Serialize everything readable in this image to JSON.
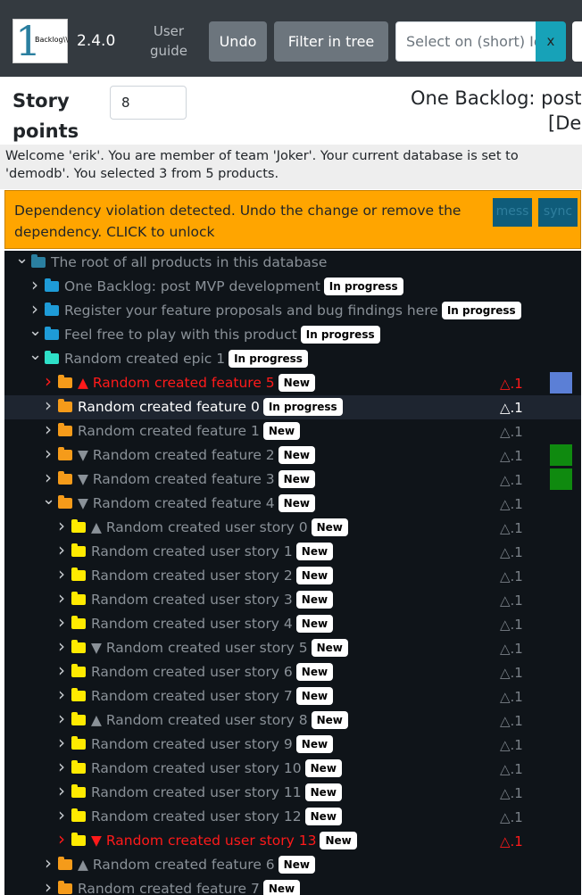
{
  "header": {
    "logo_text": "Backlog\\\\",
    "logo_number": "1",
    "version": "2.4.0",
    "user_guide": "User guide",
    "undo": "Undo",
    "filter": "Filter in tree",
    "select_placeholder": "Select on (short) Id",
    "clear": "x"
  },
  "story_points": {
    "label": "Story points",
    "value": "8"
  },
  "page_title": {
    "line1": "One Backlog: post",
    "line2": "[De"
  },
  "welcome": "Welcome 'erik'. You are member of team 'Joker'. Your current database is set to 'demodb'. You selected 3 from 5 products.",
  "alert": {
    "text": "Dependency violation detected. Undo the change or remove the dependency. CLICK to unlock",
    "mess": "mess",
    "sync": "sync"
  },
  "colors": {
    "navbar": "#343a40",
    "alert": "#ffa500",
    "tree_bg": "#0f1419",
    "violation": "#ff1a1a"
  },
  "tree": [
    {
      "name": "The root of all products in this database",
      "badge": "",
      "prefix": "",
      "chevron": "down",
      "folder": "root",
      "level": 0,
      "style": "normal",
      "delta": "",
      "marker": ""
    },
    {
      "name": "One Backlog: post MVP development",
      "badge": "In progress",
      "prefix": "",
      "chevron": "right",
      "folder": "blue",
      "level": 1,
      "style": "normal",
      "delta": "",
      "marker": ""
    },
    {
      "name": "Register your feature proposals and bug findings here",
      "badge": "In progress",
      "prefix": "",
      "chevron": "right",
      "folder": "blue",
      "level": 1,
      "style": "normal",
      "delta": "",
      "marker": ""
    },
    {
      "name": "Feel free to play with this product",
      "badge": "In progress",
      "prefix": "",
      "chevron": "down",
      "folder": "blue",
      "level": 1,
      "style": "normal",
      "delta": "",
      "marker": ""
    },
    {
      "name": "Random created epic 1",
      "badge": "In progress",
      "prefix": "",
      "chevron": "down",
      "folder": "teal",
      "level": 2,
      "style": "normal",
      "delta": "",
      "marker": ""
    },
    {
      "name": "Random created feature 5",
      "badge": "New",
      "prefix": "▲",
      "chevron": "right",
      "folder": "orange",
      "level": 3,
      "style": "red",
      "delta": "△.1",
      "marker": "blue"
    },
    {
      "name": "Random created feature 0",
      "badge": "In progress",
      "prefix": "",
      "chevron": "right",
      "folder": "orange",
      "level": 3,
      "style": "selected",
      "delta": "△.1",
      "marker": ""
    },
    {
      "name": "Random created feature 1",
      "badge": "New",
      "prefix": "",
      "chevron": "right",
      "folder": "orange",
      "level": 3,
      "style": "normal",
      "delta": "△.1",
      "marker": ""
    },
    {
      "name": "Random created feature 2",
      "badge": "New",
      "prefix": "▼",
      "chevron": "right",
      "folder": "orange",
      "level": 3,
      "style": "normal",
      "delta": "△.1",
      "marker": "green"
    },
    {
      "name": "Random created feature 3",
      "badge": "New",
      "prefix": "▼",
      "chevron": "right",
      "folder": "orange",
      "level": 3,
      "style": "normal",
      "delta": "△.1",
      "marker": "green"
    },
    {
      "name": "Random created feature 4",
      "badge": "New",
      "prefix": "▼",
      "chevron": "down",
      "folder": "orange",
      "level": 3,
      "style": "normal",
      "delta": "△.1",
      "marker": ""
    },
    {
      "name": "Random created user story 0",
      "badge": "New",
      "prefix": "▲",
      "chevron": "right",
      "folder": "yellow",
      "level": 4,
      "style": "normal",
      "delta": "△.1",
      "marker": ""
    },
    {
      "name": "Random created user story 1",
      "badge": "New",
      "prefix": "",
      "chevron": "right",
      "folder": "yellow",
      "level": 4,
      "style": "normal",
      "delta": "△.1",
      "marker": ""
    },
    {
      "name": "Random created user story 2",
      "badge": "New",
      "prefix": "",
      "chevron": "right",
      "folder": "yellow",
      "level": 4,
      "style": "normal",
      "delta": "△.1",
      "marker": ""
    },
    {
      "name": "Random created user story 3",
      "badge": "New",
      "prefix": "",
      "chevron": "right",
      "folder": "yellow",
      "level": 4,
      "style": "normal",
      "delta": "△.1",
      "marker": ""
    },
    {
      "name": "Random created user story 4",
      "badge": "New",
      "prefix": "",
      "chevron": "right",
      "folder": "yellow",
      "level": 4,
      "style": "normal",
      "delta": "△.1",
      "marker": ""
    },
    {
      "name": "Random created user story 5",
      "badge": "New",
      "prefix": "▼",
      "chevron": "right",
      "folder": "yellow",
      "level": 4,
      "style": "normal",
      "delta": "△.1",
      "marker": ""
    },
    {
      "name": "Random created user story 6",
      "badge": "New",
      "prefix": "",
      "chevron": "right",
      "folder": "yellow",
      "level": 4,
      "style": "normal",
      "delta": "△.1",
      "marker": ""
    },
    {
      "name": "Random created user story 7",
      "badge": "New",
      "prefix": "",
      "chevron": "right",
      "folder": "yellow",
      "level": 4,
      "style": "normal",
      "delta": "△.1",
      "marker": ""
    },
    {
      "name": "Random created user story 8",
      "badge": "New",
      "prefix": "▲",
      "chevron": "right",
      "folder": "yellow",
      "level": 4,
      "style": "normal",
      "delta": "△.1",
      "marker": ""
    },
    {
      "name": "Random created user story 9",
      "badge": "New",
      "prefix": "",
      "chevron": "right",
      "folder": "yellow",
      "level": 4,
      "style": "normal",
      "delta": "△.1",
      "marker": ""
    },
    {
      "name": "Random created user story 10",
      "badge": "New",
      "prefix": "",
      "chevron": "right",
      "folder": "yellow",
      "level": 4,
      "style": "normal",
      "delta": "△.1",
      "marker": ""
    },
    {
      "name": "Random created user story 11",
      "badge": "New",
      "prefix": "",
      "chevron": "right",
      "folder": "yellow",
      "level": 4,
      "style": "normal",
      "delta": "△.1",
      "marker": ""
    },
    {
      "name": "Random created user story 12",
      "badge": "New",
      "prefix": "",
      "chevron": "right",
      "folder": "yellow",
      "level": 4,
      "style": "normal",
      "delta": "△.1",
      "marker": ""
    },
    {
      "name": "Random created user story 13",
      "badge": "New",
      "prefix": "▼",
      "chevron": "right",
      "folder": "yellow",
      "level": 4,
      "style": "red",
      "delta": "△.1",
      "marker": ""
    },
    {
      "name": "Random created feature 6",
      "badge": "New",
      "prefix": "▲",
      "chevron": "right",
      "folder": "orange",
      "level": 3,
      "style": "normal",
      "delta": "",
      "marker": ""
    },
    {
      "name": "Random created feature 7",
      "badge": "New",
      "prefix": "",
      "chevron": "right",
      "folder": "orange",
      "level": 3,
      "style": "normal",
      "delta": "",
      "marker": ""
    }
  ]
}
